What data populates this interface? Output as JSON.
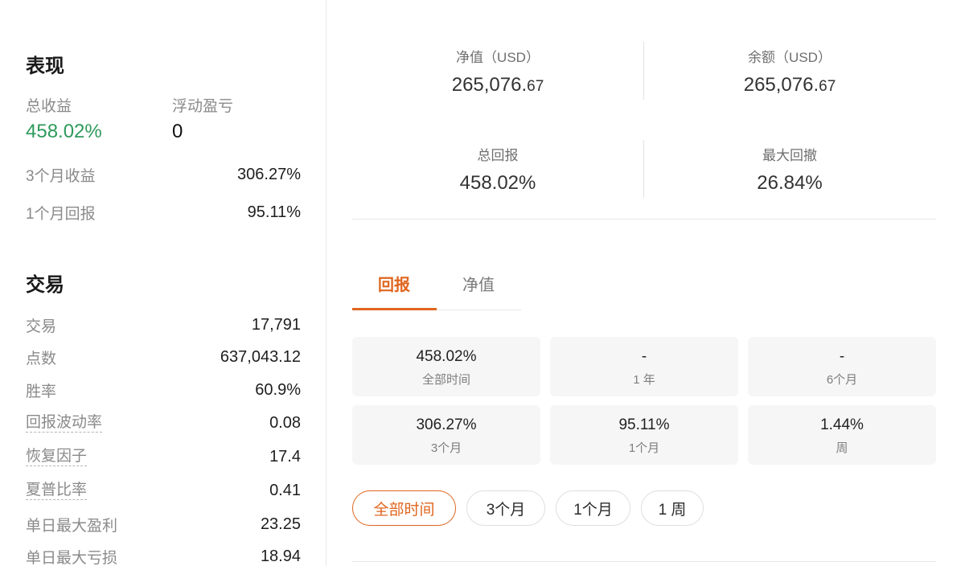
{
  "performance": {
    "title": "表现",
    "total_return_label": "总收益",
    "total_return_value": "458.02%",
    "floating_pl_label": "浮动盈亏",
    "floating_pl_value": "0",
    "rows": [
      {
        "label": "3个月收益",
        "value": "306.27%"
      },
      {
        "label": "1个月回报",
        "value": "95.11%"
      }
    ]
  },
  "trading": {
    "title": "交易",
    "rows": [
      {
        "label": "交易",
        "value": "17,791"
      },
      {
        "label": "点数",
        "value": "637,043.12"
      },
      {
        "label": "胜率",
        "value": "60.9%"
      },
      {
        "label": "回报波动率",
        "value": "0.08"
      },
      {
        "label": "恢复因子",
        "value": "17.4"
      },
      {
        "label": "夏普比率",
        "value": "0.41"
      },
      {
        "label": "单日最大盈利",
        "value": "23.25"
      },
      {
        "label": "单日最大亏损",
        "value": "18.94"
      }
    ]
  },
  "summary": {
    "net_value_label": "净值（USD）",
    "net_value_main": "265,076.",
    "net_value_cents": "67",
    "balance_label": "余额（USD）",
    "balance_main": "265,076.",
    "balance_cents": "67",
    "total_return_label": "总回报",
    "total_return_value": "458.02%",
    "max_drawdown_label": "最大回撤",
    "max_drawdown_value": "26.84%"
  },
  "tabs": [
    {
      "label": "回报",
      "active": true
    },
    {
      "label": "净值",
      "active": false
    }
  ],
  "return_cards": [
    {
      "value": "458.02%",
      "label": "全部时间"
    },
    {
      "value": "-",
      "label": "1 年"
    },
    {
      "value": "-",
      "label": "6个月"
    },
    {
      "value": "306.27%",
      "label": "3个月"
    },
    {
      "value": "95.11%",
      "label": "1个月"
    },
    {
      "value": "1.44%",
      "label": "周"
    }
  ],
  "periods": [
    {
      "label": "全部时间",
      "active": true
    },
    {
      "label": "3个月",
      "active": false
    },
    {
      "label": "1个月",
      "active": false
    },
    {
      "label": "1 周",
      "active": false
    }
  ],
  "colors": {
    "positive": "#2e9a5c",
    "accent": "#e0651e"
  }
}
